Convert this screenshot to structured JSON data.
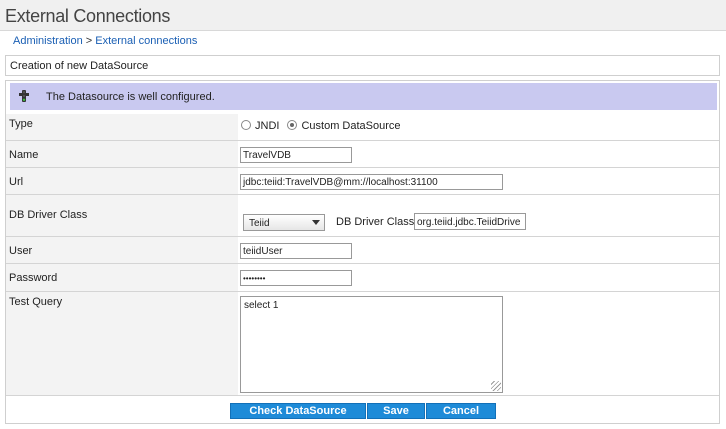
{
  "header": {
    "title": "External Connections"
  },
  "breadcrumb": {
    "root": "Administration",
    "separator": " > ",
    "current": "External connections"
  },
  "section": {
    "title": "Creation of new DataSource"
  },
  "status": {
    "message": "The Datasource is well configured.",
    "icon": "traffic-light-icon"
  },
  "form": {
    "type": {
      "label": "Type",
      "options": [
        "JNDI",
        "Custom DataSource"
      ],
      "selected": "Custom DataSource"
    },
    "name": {
      "label": "Name",
      "value": "TravelVDB"
    },
    "url": {
      "label": "Url",
      "value": "jdbc:teiid:TravelVDB@mm://localhost:31100"
    },
    "driver": {
      "label": "DB Driver Class",
      "selected": "Teiid",
      "class_label": "DB Driver Class",
      "class_value": "org.teiid.jdbc.TeiidDrive"
    },
    "user": {
      "label": "User",
      "value": "teiidUser"
    },
    "password": {
      "label": "Password",
      "value": "••••••••"
    },
    "query": {
      "label": "Test Query",
      "value": "select 1"
    }
  },
  "buttons": {
    "check": "Check DataSource",
    "save": "Save",
    "cancel": "Cancel"
  }
}
